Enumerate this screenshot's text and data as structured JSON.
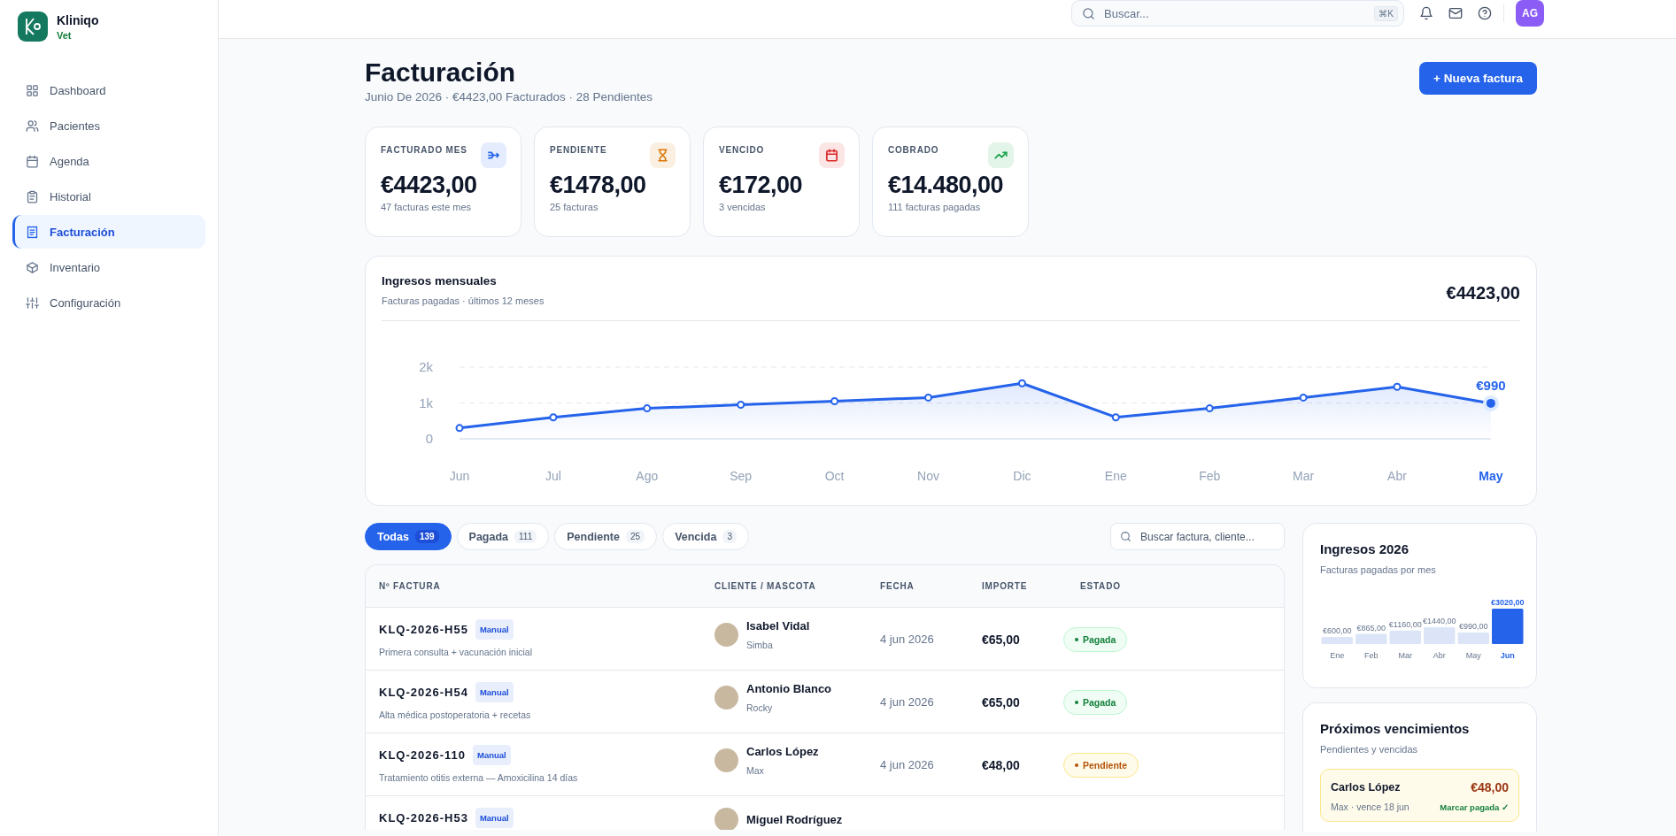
{
  "sidebar": {
    "brand": "Kliniqo",
    "brand_sub": "Vet",
    "items": [
      {
        "label": "Dashboard",
        "selected": false
      },
      {
        "label": "Pacientes",
        "selected": false
      },
      {
        "label": "Agenda",
        "selected": false
      },
      {
        "label": "Historial",
        "selected": false
      },
      {
        "label": "Facturación",
        "selected": true
      },
      {
        "label": "Inventario",
        "selected": false
      },
      {
        "label": "Configuración",
        "selected": false
      }
    ]
  },
  "topbar": {
    "search": {
      "placeholder": "Buscar..."
    },
    "shortcut": "⌘K",
    "avatar": "AG"
  },
  "header": {
    "title": "Facturación",
    "subtitle": "Junio De 2026 · €4423,00 Facturados · 28 Pendientes",
    "primary_button": "+ Nueva factura"
  },
  "kpis": [
    {
      "label": "FACTURADO MES",
      "value": "€4423,00",
      "note": "47 facturas este mes",
      "color": "#2563eb"
    },
    {
      "label": "PENDIENTE",
      "value": "€1478,00",
      "note": "25 facturas",
      "color": "#d97706"
    },
    {
      "label": "VENCIDO",
      "value": "€172,00",
      "note": "3 vencidas",
      "color": "#dc2626"
    },
    {
      "label": "COBRADO",
      "value": "€14.480,00",
      "note": "111 facturas pagadas",
      "color": "#16a34a"
    }
  ],
  "revenue": {
    "title": "Ingresos mensuales",
    "subtitle": "Facturas pagadas · últimos 12 meses",
    "total": "€4423,00",
    "chart_data": {
      "type": "area",
      "categories": [
        "Jun",
        "Jul",
        "Ago",
        "Sep",
        "Oct",
        "Nov",
        "Dic",
        "Ene",
        "Feb",
        "Mar",
        "Abr",
        "May"
      ],
      "series": [
        {
          "color": "#2563eb",
          "marker": true,
          "values": [
            300,
            600,
            850,
            950,
            1050,
            1150,
            1550,
            600,
            850,
            1150,
            1450,
            990
          ]
        }
      ],
      "ylim": [
        0,
        2000
      ],
      "yticks": [
        {
          "value": 0,
          "label": "0"
        },
        {
          "value": 1000,
          "label": "1k"
        },
        {
          "value": 2000,
          "label": "2k"
        }
      ],
      "annotations": [
        {
          "x": "May",
          "y": 990,
          "text": "€990"
        }
      ]
    }
  },
  "filters": {
    "tabs": [
      {
        "label": "Todas",
        "count": "139",
        "selected": true
      },
      {
        "label": "Pagada",
        "count": "111",
        "selected": false
      },
      {
        "label": "Pendiente",
        "count": "25",
        "selected": false
      },
      {
        "label": "Vencida",
        "count": "3",
        "selected": false
      }
    ],
    "search": {
      "placeholder": "Buscar factura, cliente..."
    }
  },
  "table": {
    "columns": [
      "Nº FACTURA",
      "CLIENTE / MASCOTA",
      "FECHA",
      "IMPORTE",
      "ESTADO"
    ],
    "rows": [
      {
        "invoice": "KLQ-2026-H55",
        "tag": "Manual",
        "description": "Primera consulta + vacunación inicial",
        "client": "Isabel Vidal",
        "pet": "Simba",
        "date": "4 jun 2026",
        "amount": "€65,00",
        "status": {
          "label": "Pagada",
          "kind": "paid"
        }
      },
      {
        "invoice": "KLQ-2026-H54",
        "tag": "Manual",
        "description": "Alta médica postoperatoria + recetas",
        "client": "Antonio Blanco",
        "pet": "Rocky",
        "date": "4 jun 2026",
        "amount": "€65,00",
        "status": {
          "label": "Pagada",
          "kind": "paid"
        }
      },
      {
        "invoice": "KLQ-2026-110",
        "tag": "Manual",
        "description": "Tratamiento otitis externa — Amoxicilina 14 días",
        "client": "Carlos López",
        "pet": "Max",
        "date": "4 jun 2026",
        "amount": "€48,00",
        "status": {
          "label": "Pendiente",
          "kind": "pending"
        }
      },
      {
        "invoice": "KLQ-2026-H53",
        "tag": "Manual",
        "client": "Miguel Rodríguez"
      }
    ]
  },
  "yearly": {
    "title": "Ingresos 2026",
    "subtitle": "Facturas pagadas por mes",
    "chart_data": {
      "type": "bar",
      "categories": [
        "Ene",
        "Feb",
        "Mar",
        "Abr",
        "May",
        "Jun"
      ],
      "values": [
        600,
        865,
        1160,
        1440,
        990,
        3020
      ],
      "value_labels": [
        "€600,00",
        "€865,00",
        "€1160,00",
        "€1440,00",
        "€990,00",
        "€3020,00"
      ],
      "annotations": [
        {
          "x": "Jun"
        }
      ]
    }
  },
  "upcoming": {
    "title": "Próximos vencimientos",
    "subtitle": "Pendientes y vencidas",
    "items": [
      {
        "client": "Carlos López",
        "amount": "€48,00",
        "detail": "Max · vence 18 jun",
        "action": "Marcar pagada ✓",
        "kind": "pending"
      }
    ]
  }
}
